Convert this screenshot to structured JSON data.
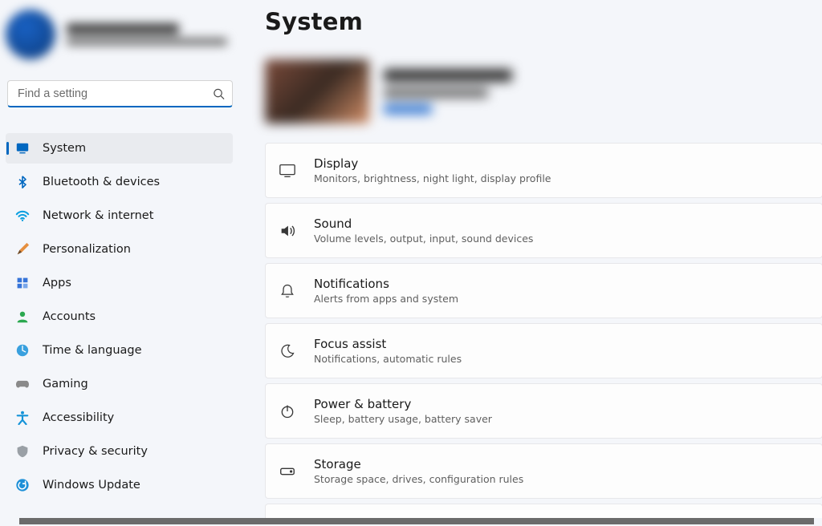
{
  "account": {
    "name_placeholder": "",
    "email_placeholder": ""
  },
  "search": {
    "placeholder": "Find a setting"
  },
  "sidebar": {
    "items": [
      {
        "id": "system",
        "label": "System",
        "active": true
      },
      {
        "id": "bluetooth",
        "label": "Bluetooth & devices",
        "active": false
      },
      {
        "id": "network",
        "label": "Network & internet",
        "active": false
      },
      {
        "id": "personalization",
        "label": "Personalization",
        "active": false
      },
      {
        "id": "apps",
        "label": "Apps",
        "active": false
      },
      {
        "id": "accounts",
        "label": "Accounts",
        "active": false
      },
      {
        "id": "time",
        "label": "Time & language",
        "active": false
      },
      {
        "id": "gaming",
        "label": "Gaming",
        "active": false
      },
      {
        "id": "accessibility",
        "label": "Accessibility",
        "active": false
      },
      {
        "id": "privacy",
        "label": "Privacy & security",
        "active": false
      },
      {
        "id": "update",
        "label": "Windows Update",
        "active": false
      }
    ]
  },
  "page": {
    "title": "System"
  },
  "cards": [
    {
      "id": "display",
      "title": "Display",
      "sub": "Monitors, brightness, night light, display profile"
    },
    {
      "id": "sound",
      "title": "Sound",
      "sub": "Volume levels, output, input, sound devices"
    },
    {
      "id": "notifications",
      "title": "Notifications",
      "sub": "Alerts from apps and system"
    },
    {
      "id": "focus",
      "title": "Focus assist",
      "sub": "Notifications, automatic rules"
    },
    {
      "id": "power",
      "title": "Power & battery",
      "sub": "Sleep, battery usage, battery saver"
    },
    {
      "id": "storage",
      "title": "Storage",
      "sub": "Storage space, drives, configuration rules"
    }
  ],
  "colors": {
    "accent": "#0067c0"
  }
}
